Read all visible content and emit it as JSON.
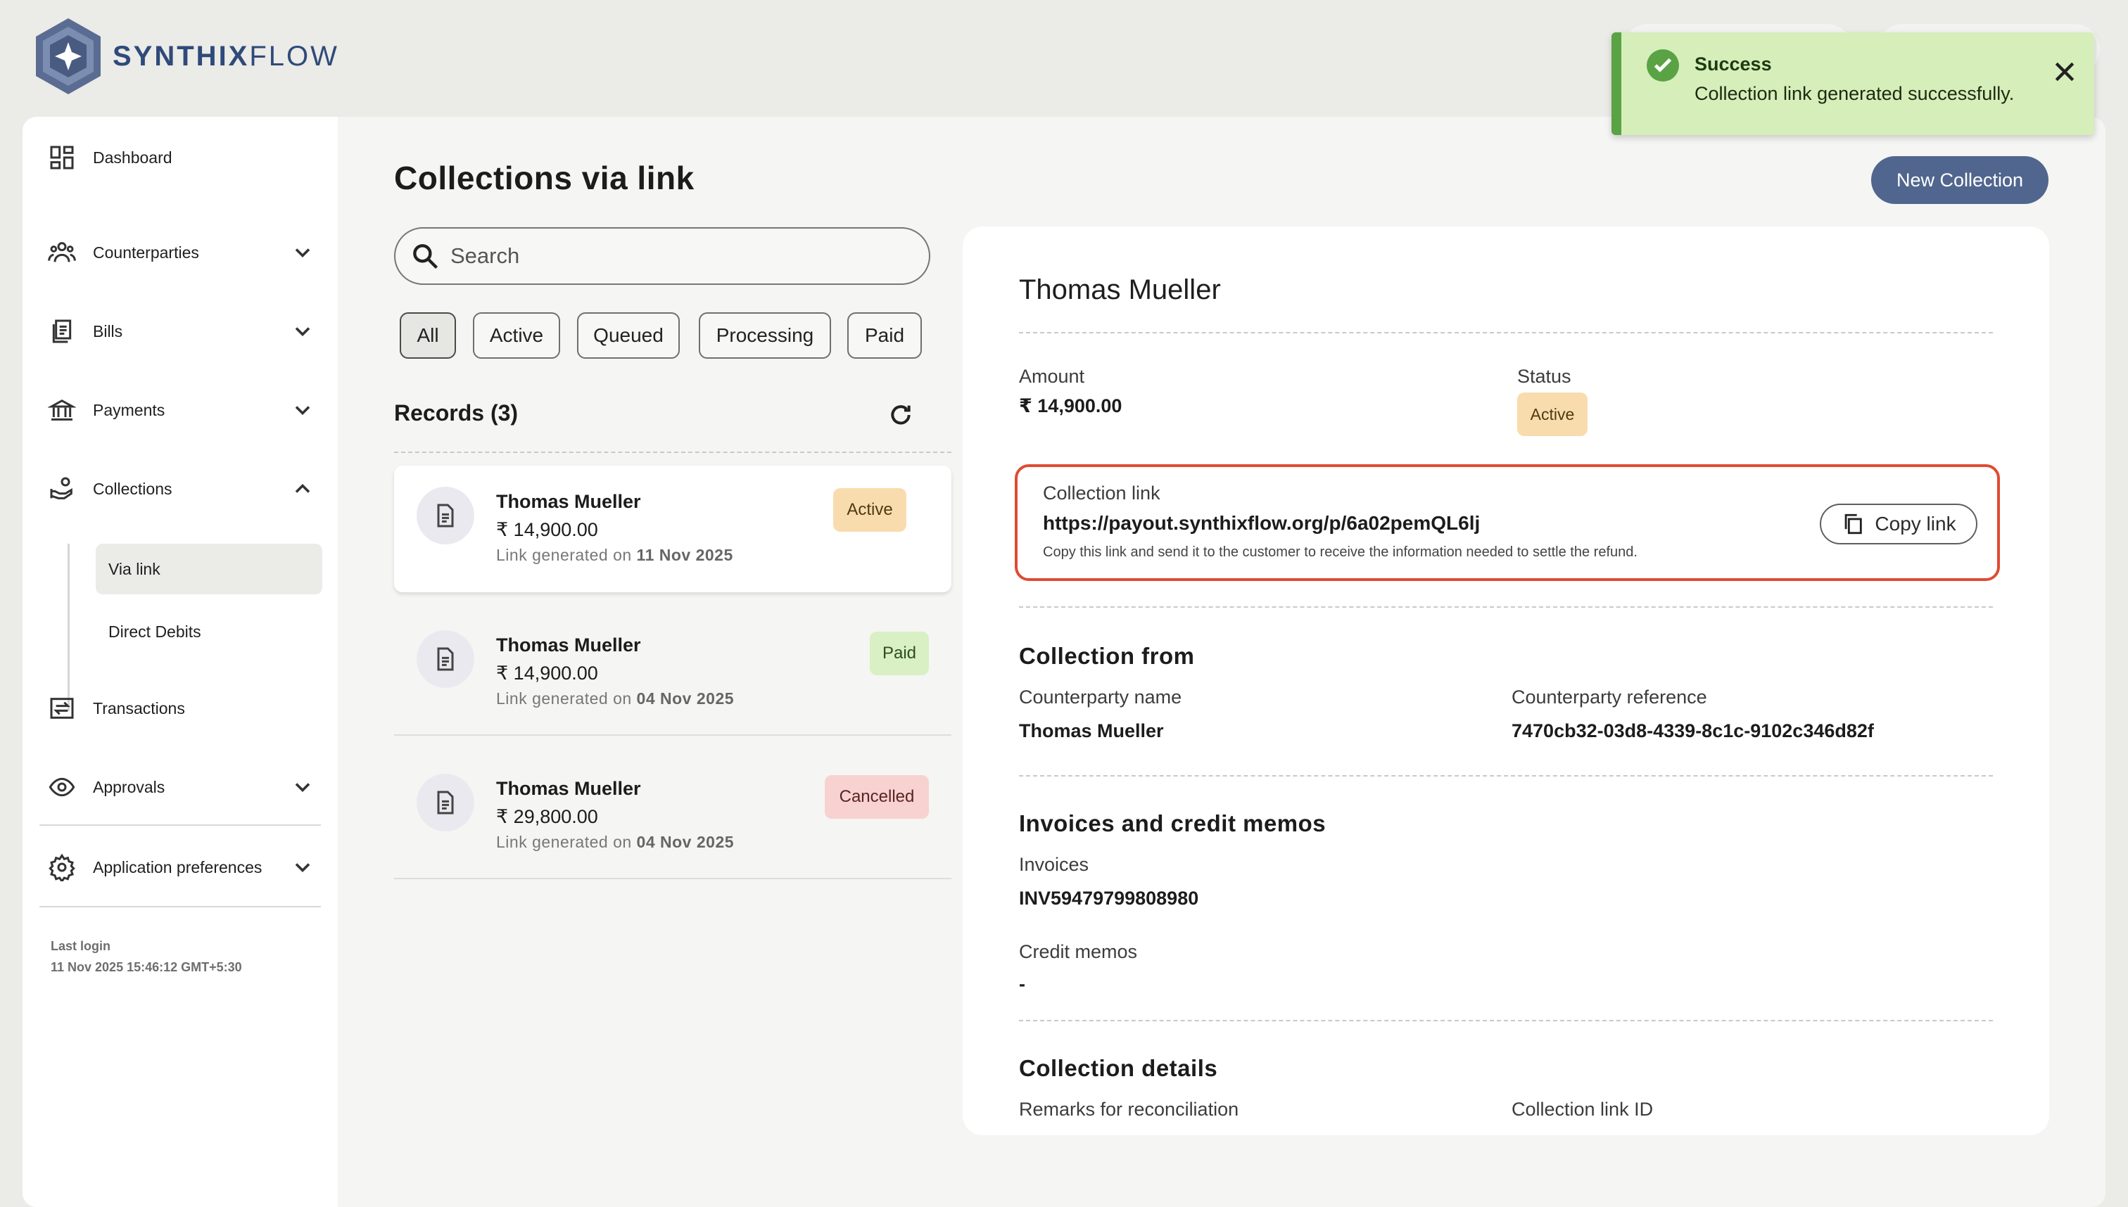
{
  "brand": {
    "name_bold": "SYNTHIX",
    "name_light": "FLOW",
    "logo_icon": "hexagon-star-logo"
  },
  "sidebar": {
    "items": [
      {
        "label": "Dashboard",
        "icon": "dashboard-icon"
      },
      {
        "label": "Counterparties",
        "icon": "people-icon",
        "expandable": true
      },
      {
        "label": "Bills",
        "icon": "bills-icon",
        "expandable": true
      },
      {
        "label": "Payments",
        "icon": "bank-icon",
        "expandable": true
      },
      {
        "label": "Collections",
        "icon": "collections-icon",
        "expanded": true
      },
      {
        "label": "Transactions",
        "icon": "transactions-icon"
      },
      {
        "label": "Approvals",
        "icon": "eye-icon",
        "expandable": true
      },
      {
        "label": "Application preferences",
        "icon": "gear-icon",
        "expandable": true
      }
    ],
    "sub_items": [
      {
        "label": "Via link",
        "active": true
      },
      {
        "label": "Direct Debits",
        "active": false
      }
    ],
    "last_login_label": "Last login",
    "last_login_value": "11 Nov 2025 15:46:12 GMT+5:30"
  },
  "main": {
    "title": "Collections via link",
    "search_placeholder": "Search",
    "filters": [
      "All",
      "Active",
      "Queued",
      "Processing",
      "Paid"
    ],
    "selected_filter": "All",
    "records_title": "Records (3)",
    "records": [
      {
        "name": "Thomas Mueller",
        "amount": "₹ 14,900.00",
        "date_prefix": "Link generated on",
        "date": "11 Nov 2025",
        "status": "Active"
      },
      {
        "name": "Thomas Mueller",
        "amount": "₹ 14,900.00",
        "date_prefix": "Link generated on",
        "date": "04 Nov 2025",
        "status": "Paid"
      },
      {
        "name": "Thomas Mueller",
        "amount": "₹ 29,800.00",
        "date_prefix": "Link generated on",
        "date": "04 Nov 2025",
        "status": "Cancelled"
      }
    ],
    "new_collection_label": "New Collection"
  },
  "detail": {
    "name": "Thomas Mueller",
    "amount_label": "Amount",
    "amount_value": "₹ 14,900.00",
    "status_label": "Status",
    "status_value": "Active",
    "collection_link_label": "Collection link",
    "collection_link_url": "https://payout.synthixflow.org/p/6a02pemQL6lj",
    "collection_link_hint": "Copy this link and send it to the customer to receive the information needed to settle the refund.",
    "copy_link_label": "Copy link",
    "collection_from_title": "Collection from",
    "counterparty_name_label": "Counterparty name",
    "counterparty_name_value": "Thomas Mueller",
    "counterparty_ref_label": "Counterparty reference",
    "counterparty_ref_value": "7470cb32-03d8-4339-8c1c-9102c346d82f",
    "invoices_title": "Invoices and credit memos",
    "invoices_label": "Invoices",
    "invoices_value": "INV59479799808980",
    "credit_memos_label": "Credit memos",
    "credit_memos_value": "-",
    "collection_details_title": "Collection details",
    "remarks_label": "Remarks for reconciliation",
    "link_id_label": "Collection link ID"
  },
  "toast": {
    "title": "Success",
    "message": "Collection link generated successfully."
  },
  "colors": {
    "accent": "#51668e",
    "highlight_border": "#e04b32",
    "toast_bg": "#d6eeba",
    "active_badge": "#f9dcae",
    "paid_badge": "#d8f0c4",
    "cancelled_badge": "#f7d2d1"
  }
}
